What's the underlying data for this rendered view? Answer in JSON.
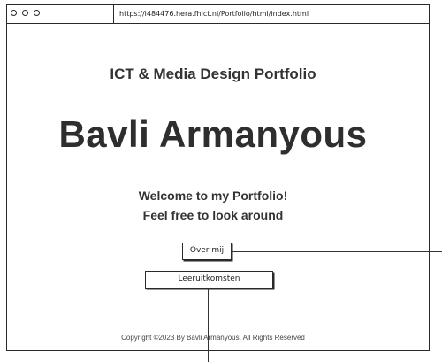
{
  "browser": {
    "url": "https://i484476.hera.fhict.nl/Portfolio/html/index.html"
  },
  "header": {
    "subtitle": "ICT & Media Design Portfolio",
    "name": "Bavli Armanyous"
  },
  "welcome": {
    "line1": "Welcome to my Portfolio!",
    "line2": "Feel free to look around"
  },
  "nav": {
    "over_mij": "Over mij",
    "leeruitkomsten": "Leeruitkomsten"
  },
  "footer": {
    "copyright": "Copyright ©2023 By Bavli Armanyous, All Rights Reserved"
  }
}
